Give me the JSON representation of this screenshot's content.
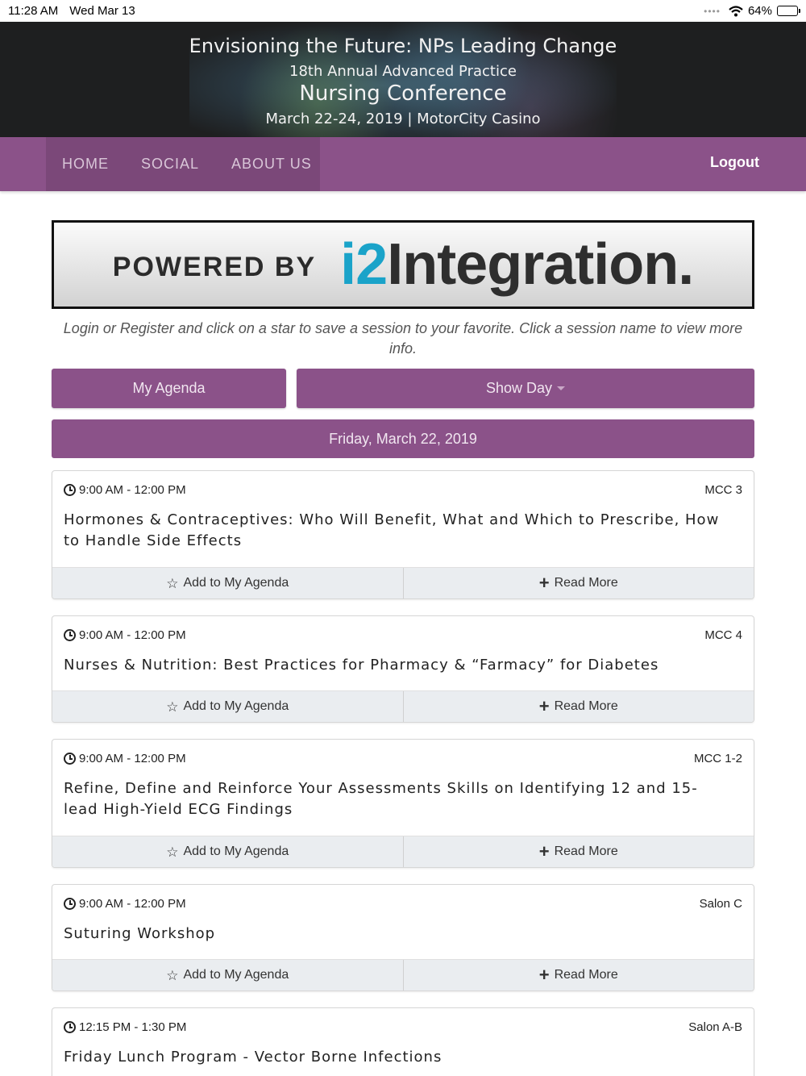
{
  "status_bar": {
    "time": "11:28 AM",
    "date": "Wed Mar 13",
    "battery": "64%",
    "battery_level": 0.64,
    "wifi_icon": "wifi-icon"
  },
  "banner": {
    "line1": "Envisioning the Future: NPs Leading Change",
    "line2": "18th Annual Advanced Practice",
    "line3": "Nursing Conference",
    "line4": "March 22-24, 2019 | MotorCity Casino"
  },
  "nav": {
    "home": "HOME",
    "social": "SOCIAL",
    "about": "ABOUT US",
    "logout": "Logout"
  },
  "powered_by": {
    "prefix": "POWERED BY",
    "brand_i2": "i2",
    "brand_rest": "Integration."
  },
  "intro": "Login or Register and click on a star to save a session to your favorite. Click a session name to view more info.",
  "buttons": {
    "my_agenda": "My Agenda",
    "show_day": "Show Day"
  },
  "day_header": "Friday, March 22, 2019",
  "actions": {
    "add": "Add to My Agenda",
    "read_more": "Read More"
  },
  "sessions": [
    {
      "time": "9:00 AM - 12:00 PM",
      "room": "MCC 3",
      "title": "Hormones & Contraceptives: Who Will Benefit, What and Which to Prescribe, How to Handle Side Effects"
    },
    {
      "time": "9:00 AM - 12:00 PM",
      "room": "MCC 4",
      "title": "Nurses & Nutrition: Best Practices for Pharmacy & “Farmacy” for Diabetes"
    },
    {
      "time": "9:00 AM - 12:00 PM",
      "room": "MCC 1-2",
      "title": "Refine, Define and Reinforce Your Assessments Skills on Identifying 12 and 15-lead High-Yield ECG Findings"
    },
    {
      "time": "9:00 AM - 12:00 PM",
      "room": "Salon C",
      "title": "Suturing Workshop"
    },
    {
      "time": "12:15 PM - 1:30 PM",
      "room": "Salon A-B",
      "title": "Friday Lunch Program - Vector Borne Infections"
    }
  ],
  "colors": {
    "nav": "#8b5289",
    "nav_active": "#7b4879",
    "brand_i2": "#1aa3c9",
    "action_bar": "#eaedf0"
  }
}
